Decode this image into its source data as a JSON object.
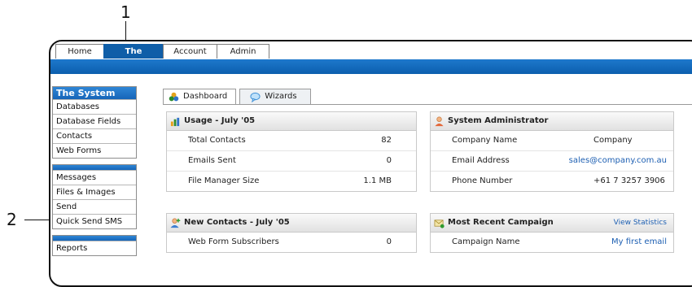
{
  "callouts": [
    "1",
    "2"
  ],
  "top_tabs": [
    "Home",
    "The System",
    "Account",
    "Admin"
  ],
  "sidebar": {
    "section_title": "The System",
    "group1": [
      "Databases",
      "Database Fields",
      "Contacts",
      "Web Forms"
    ],
    "group2": [
      "Messages",
      "Files & Images",
      "Send",
      "Quick Send SMS"
    ],
    "group3": [
      "Reports"
    ]
  },
  "content_tabs": [
    "Dashboard",
    "Wizards"
  ],
  "usage": {
    "title": "Usage - July '05",
    "rows": [
      {
        "label": "Total Contacts",
        "value": "82"
      },
      {
        "label": "Emails Sent",
        "value": "0"
      },
      {
        "label": "File Manager Size",
        "value": "1.1 MB"
      }
    ]
  },
  "admin": {
    "title": "System Administrator",
    "rows": [
      {
        "label": "Company Name",
        "value": "Company"
      },
      {
        "label": "Email Address",
        "value": "sales@company.com.au"
      },
      {
        "label": "Phone Number",
        "value": "+61 7 3257 3906"
      }
    ]
  },
  "new_contacts": {
    "title": "New Contacts - July '05",
    "rows": [
      {
        "label": "Web Form Subscribers",
        "value": "0"
      }
    ]
  },
  "campaign": {
    "title": "Most Recent Campaign",
    "link": "View Statistics",
    "rows": [
      {
        "label": "Campaign Name",
        "value": "My first email"
      }
    ]
  },
  "colors": {
    "accent": "#0f5ea8",
    "link": "#1d5fb2"
  },
  "icons": {
    "dashboard": "dashboard-icon",
    "wizards": "speech-bubble-icon",
    "usage": "chart-icon",
    "admin": "user-icon",
    "new_contacts": "add-user-icon",
    "campaign": "campaign-icon"
  }
}
